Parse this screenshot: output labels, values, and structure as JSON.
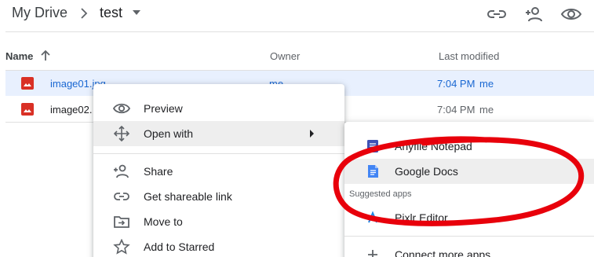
{
  "breadcrumb": {
    "root": "My Drive",
    "current": "test"
  },
  "header_actions": [
    {
      "icon": "link-icon"
    },
    {
      "icon": "add-person-icon"
    },
    {
      "icon": "eye-icon"
    }
  ],
  "columns": {
    "name": "Name",
    "owner": "Owner",
    "last_modified": "Last modified"
  },
  "files": [
    {
      "name": "image01.jpg",
      "owner": "me",
      "time": "7:04 PM",
      "modified_by": "me",
      "selected": true
    },
    {
      "name": "image02.",
      "owner": "",
      "time": "7:04 PM",
      "modified_by": "me",
      "selected": false
    }
  ],
  "context_menu": {
    "items": [
      {
        "label": "Preview",
        "icon": "eye-icon"
      },
      {
        "label": "Open with",
        "icon": "move-arrows-icon",
        "has_submenu": true
      },
      {
        "label": "Share",
        "icon": "add-person-icon"
      },
      {
        "label": "Get shareable link",
        "icon": "link-icon"
      },
      {
        "label": "Move to",
        "icon": "folder-move-icon"
      },
      {
        "label": "Add to Starred",
        "icon": "star-icon"
      }
    ]
  },
  "open_with_submenu": {
    "items": [
      {
        "label": "Anyfile Notepad",
        "icon": "notepad-app-icon"
      },
      {
        "label": "Google Docs",
        "icon": "google-docs-icon"
      },
      {
        "label": "Pixlr Editor",
        "icon": "pixlr-app-icon"
      },
      {
        "label": "Connect more apps",
        "icon": "plus-icon"
      }
    ],
    "suggested_caption": "Suggested apps"
  },
  "colors": {
    "selection": "#e8f0fe",
    "link_blue": "#1967d2",
    "menu_hover": "#eeeeee",
    "image_icon_red": "#d93025",
    "docs_blue": "#4285f4",
    "annotation_red": "#e8000b"
  }
}
